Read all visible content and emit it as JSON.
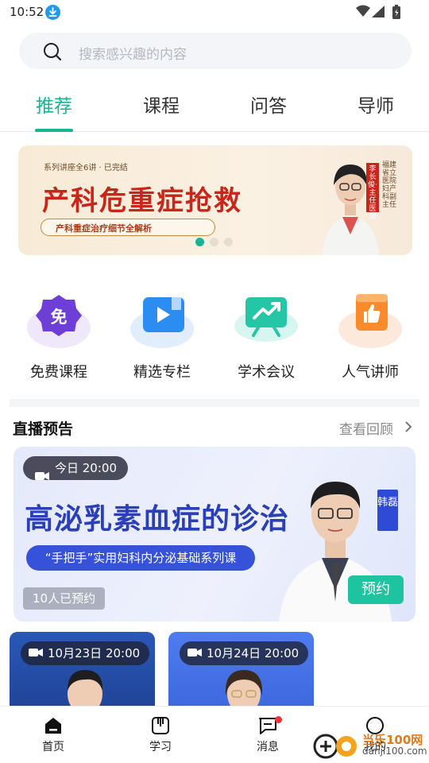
{
  "status_bar": {
    "time": "10:52"
  },
  "search": {
    "placeholder": "搜索感兴趣的内容"
  },
  "tabs": [
    {
      "label": "推荐",
      "active": true
    },
    {
      "label": "课程",
      "active": false
    },
    {
      "label": "问答",
      "active": false
    },
    {
      "label": "导师",
      "active": false
    }
  ],
  "banner": {
    "subtitle": "系列讲座全6讲 · 已完结",
    "title": "产科危重症抢救",
    "pill": "产科重症治疗细节全解析",
    "badge": "李长俊·主任医师",
    "hospital": "福建省立医院 妇产科副主任",
    "dots": 3,
    "active_dot": 1
  },
  "quick_links": [
    {
      "label": "免费课程",
      "icon": "free-course-icon",
      "glyph": "免"
    },
    {
      "label": "精选专栏",
      "icon": "column-video-icon"
    },
    {
      "label": "学术会议",
      "icon": "conference-chart-icon"
    },
    {
      "label": "人气讲师",
      "icon": "thumbs-up-icon"
    }
  ],
  "live_section": {
    "title": "直播预告",
    "more": "查看回顾"
  },
  "live_main": {
    "time": "今日 20:00",
    "title": "高泌乳素血症的诊治",
    "series": "“手把手”实用妇科内分泌基础系列课",
    "booked": "10人已预约",
    "lecturer_tag": "韩磊",
    "button": "预约"
  },
  "live_small": [
    {
      "time": "10月23日 20:00"
    },
    {
      "time": "10月24日 20:00"
    }
  ],
  "bottom_nav": [
    {
      "label": "首页",
      "icon": "home-icon",
      "active": true
    },
    {
      "label": "学习",
      "icon": "book-icon",
      "active": false
    },
    {
      "label": "消息",
      "icon": "message-icon",
      "active": false,
      "badge": true
    },
    {
      "label": "我的",
      "icon": "profile-icon",
      "active": false
    }
  ],
  "watermark": {
    "text": "当乐100网",
    "url": "danji100.com"
  },
  "colors": {
    "accent": "#1ab394",
    "live_title": "#2a3fb8",
    "banner_title": "#c8261a",
    "badge_red": "#f0313a"
  }
}
